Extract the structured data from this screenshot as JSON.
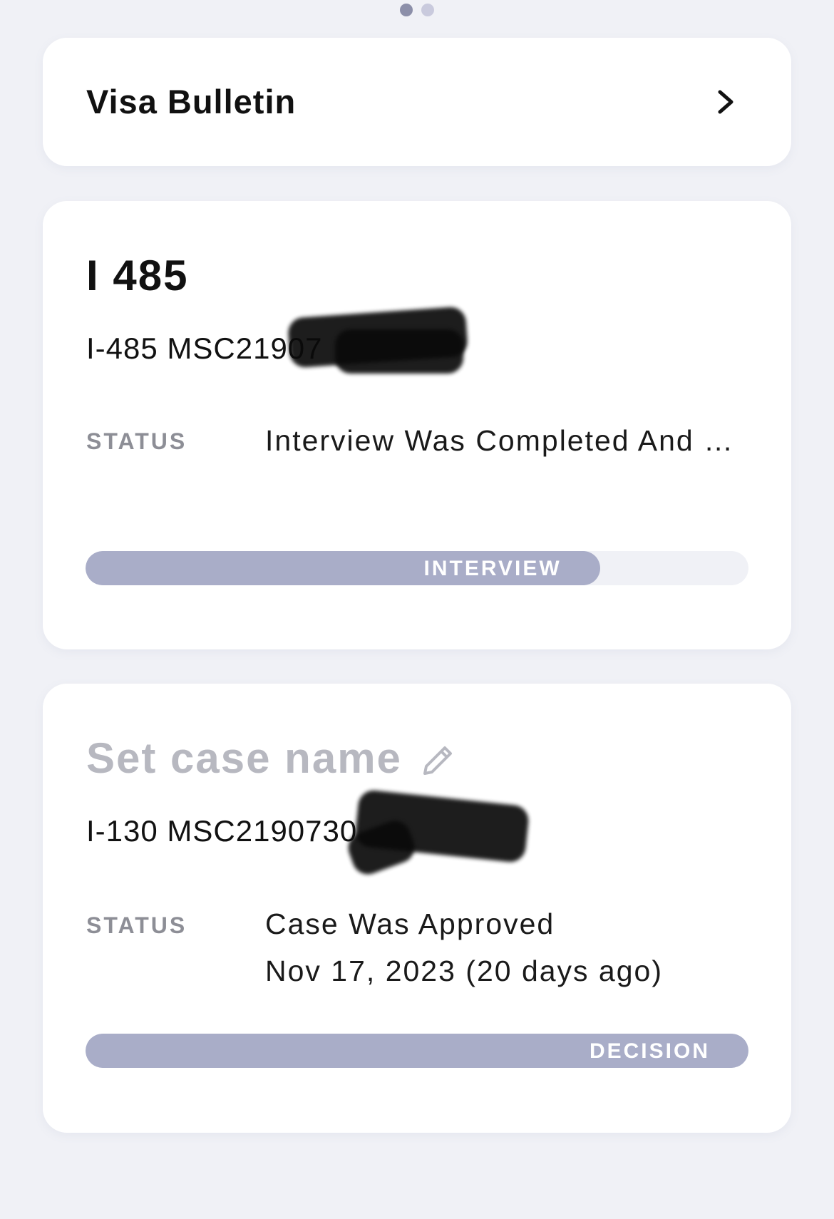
{
  "pager": {
    "count": 2,
    "active_index": 0
  },
  "visa_bulletin": {
    "title": "Visa Bulletin",
    "chevron_icon": "chevron-right-icon"
  },
  "cases": [
    {
      "title": "I 485",
      "receipt": "I-485 MSC21907",
      "status_label": "STATUS",
      "status_text": "Interview Was Completed And …",
      "stage_label": "INTERVIEW",
      "progress": 0.776
    },
    {
      "title": "Set case name",
      "title_icon": "pencil-icon",
      "receipt": "I-130 MSC2190730",
      "status_label": "STATUS",
      "status_text": "Case Was Approved",
      "status_date": "Nov 17, 2023 (20 days ago)",
      "stage_label": "DECISION",
      "progress": 1.0
    }
  ],
  "colors": {
    "background": "#f0f1f6",
    "card": "#ffffff",
    "progress_fill": "#a9adc8",
    "progress_track": "#f0f1f6",
    "placeholder_text": "#b7b8c0",
    "label_gray": "#8d8e96"
  }
}
